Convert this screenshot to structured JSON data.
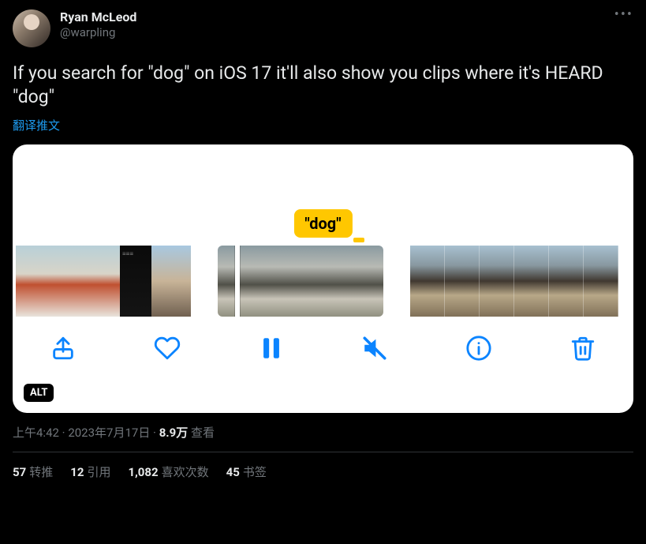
{
  "user": {
    "display_name": "Ryan McLeod",
    "handle": "@warpling"
  },
  "tweet": {
    "text": "If you search for \"dog\" on iOS 17 it'll also show you clips where it's HEARD \"dog\"",
    "translate_label": "翻译推文"
  },
  "media": {
    "caption_pill": "\"dog\"",
    "alt_badge": "ALT",
    "controls": {
      "share": "share",
      "like": "like",
      "pause": "pause",
      "mute": "mute",
      "info": "info",
      "delete": "delete"
    }
  },
  "meta": {
    "time": "上午4:42",
    "date": "2023年7月17日",
    "views_number": "8.9万",
    "views_label": "查看",
    "separator": " · "
  },
  "stats": {
    "retweets": {
      "count": "57",
      "label": "转推"
    },
    "quotes": {
      "count": "12",
      "label": "引用"
    },
    "likes": {
      "count": "1,082",
      "label": "喜欢次数"
    },
    "bookmarks": {
      "count": "45",
      "label": "书签"
    }
  },
  "more_label": "•••"
}
